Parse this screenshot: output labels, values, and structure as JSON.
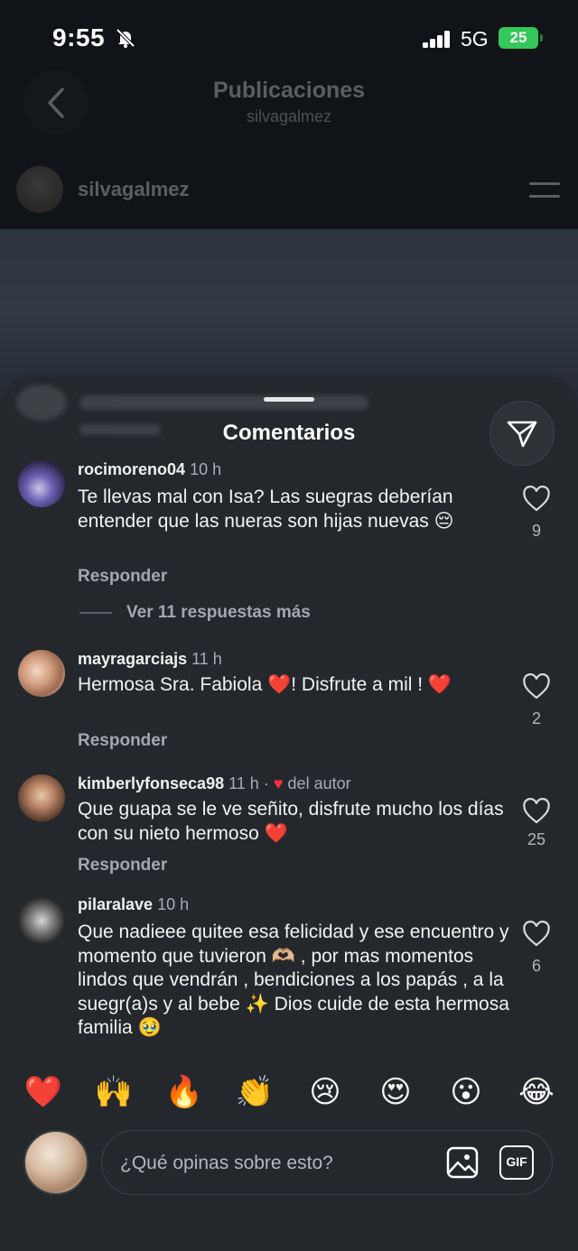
{
  "status_bar": {
    "time": "9:55",
    "network": "5G",
    "battery": "25"
  },
  "header": {
    "title": "Publicaciones",
    "subtitle": "silvagalmez"
  },
  "post": {
    "author": "silvagalmez"
  },
  "sheet": {
    "title": "Comentarios"
  },
  "comments": [
    {
      "username": "rocimoreno04",
      "time": "10 h",
      "text": "Te llevas mal con Isa? Las suegras deberían entender que las nueras son hijas nuevas 😔",
      "likes": "9",
      "reply_label": "Responder",
      "more_replies": "Ver 11 respuestas más"
    },
    {
      "username": "mayragarciajs",
      "time": "11 h",
      "text": "Hermosa Sra. Fabiola ❤️! Disfrute a mil ! ❤️",
      "likes": "2",
      "reply_label": "Responder"
    },
    {
      "username": "kimberlyfonseca98",
      "time": "11 h",
      "author_like": "del autor",
      "text": "Que guapa se le ve señito, disfrute mucho los días con su nieto hermoso ❤️",
      "likes": "25",
      "reply_label": "Responder"
    },
    {
      "username": "pilaralave",
      "time": "10 h",
      "text": "Que nadieee quitee esa felicidad y ese encuentro y momento que tuvieron 🫶🏼 , por mas momentos lindos que vendrán , bendiciones a los papás , a la suegr(a)s y al bebe ✨ Dios cuide de esta hermosa familia 🥹",
      "likes": "6"
    }
  ],
  "reactions": [
    "❤️",
    "🙌",
    "🔥",
    "👏",
    "😢",
    "😍",
    "😮",
    "😂"
  ],
  "composer": {
    "placeholder": "¿Qué opinas sobre esto?",
    "gif_label": "GIF"
  },
  "icons": {
    "status": [
      "bell-off-icon",
      "signal-icon",
      "battery-icon"
    ],
    "header": [
      "back-icon",
      "menu-icon"
    ],
    "sheet": [
      "send-icon",
      "heart-outline-icon",
      "gallery-icon"
    ]
  },
  "colors": {
    "sheet_bg": "#24282d",
    "like_red": "#ff3040",
    "battery_green": "#34c759"
  }
}
